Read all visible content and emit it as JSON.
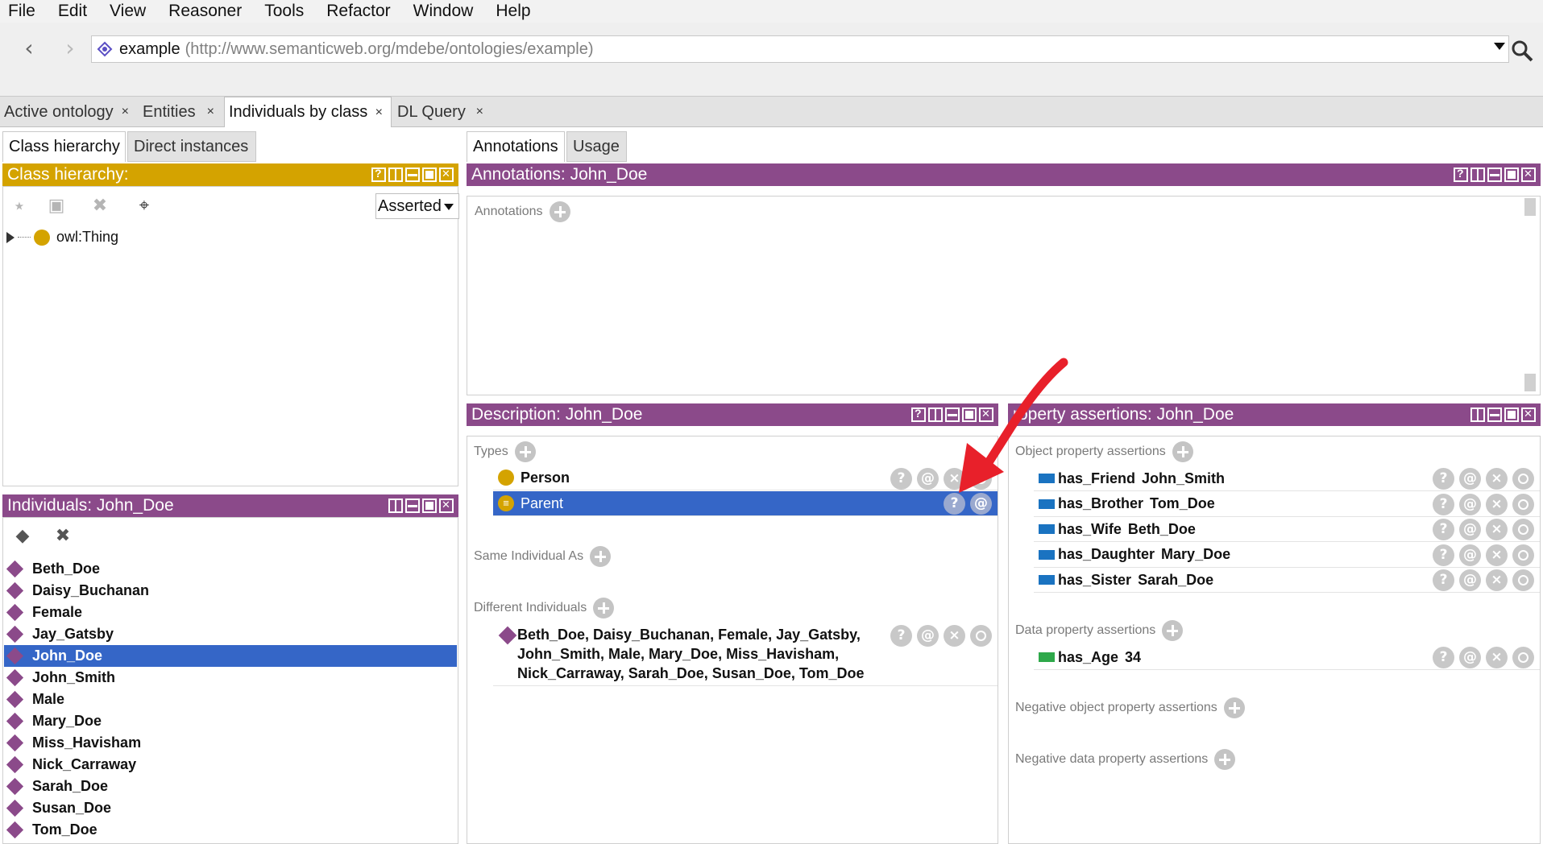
{
  "menu": [
    "File",
    "Edit",
    "View",
    "Reasoner",
    "Tools",
    "Refactor",
    "Window",
    "Help"
  ],
  "address": {
    "name": "example",
    "url": "(http://www.semanticweb.org/mdebe/ontologies/example)"
  },
  "tabs": [
    {
      "label": "Active ontology",
      "close": "×"
    },
    {
      "label": "Entities",
      "close": "×"
    },
    {
      "label": "Individuals by class",
      "close": "×"
    },
    {
      "label": "DL Query",
      "close": "×"
    }
  ],
  "left_subtabs": [
    "Class hierarchy",
    "Direct instances"
  ],
  "right_subtabs": [
    "Annotations",
    "Usage"
  ],
  "class_hierarchy": {
    "title": "Class hierarchy:",
    "mode": "Asserted",
    "root": "owl:Thing"
  },
  "individuals": {
    "title": "Individuals: John_Doe",
    "items": [
      "Beth_Doe",
      "Daisy_Buchanan",
      "Female",
      "Jay_Gatsby",
      "John_Doe",
      "John_Smith",
      "Male",
      "Mary_Doe",
      "Miss_Havisham",
      "Nick_Carraway",
      "Sarah_Doe",
      "Susan_Doe",
      "Tom_Doe"
    ],
    "selected": "John_Doe"
  },
  "annotations": {
    "title": "Annotations: John_Doe",
    "section": "Annotations"
  },
  "description": {
    "title": "Description: John_Doe",
    "types_label": "Types",
    "types": [
      {
        "label": "Person",
        "selected": false
      },
      {
        "label": "Parent",
        "selected": true
      }
    ],
    "same_label": "Same Individual As",
    "different_label": "Different Individuals",
    "different_lines": [
      "Beth_Doe, Daisy_Buchanan, Female, Jay_Gatsby,",
      "John_Smith, Male, Mary_Doe, Miss_Havisham,",
      "Nick_Carraway, Sarah_Doe, Susan_Doe, Tom_Doe"
    ]
  },
  "property_assertions": {
    "title": "roperty assertions: John_Doe",
    "object_label": "Object property assertions",
    "object": [
      {
        "property": "has_Friend",
        "value": "John_Smith"
      },
      {
        "property": "has_Brother",
        "value": "Tom_Doe"
      },
      {
        "property": "has_Wife",
        "value": "Beth_Doe"
      },
      {
        "property": "has_Daughter",
        "value": "Mary_Doe"
      },
      {
        "property": "has_Sister",
        "value": "Sarah_Doe"
      }
    ],
    "data_label": "Data property assertions",
    "data": [
      {
        "property": "has_Age",
        "value": "34"
      }
    ],
    "neg_object_label": "Negative object property assertions",
    "neg_data_label": "Negative data property assertions"
  },
  "buttons": {
    "help": "?",
    "annotate": "@",
    "delete": "×"
  },
  "colors": {
    "class_header": "#d4a300",
    "view_header": "#8b4a8a",
    "selection": "#3566c7",
    "object_property": "#1a73c1",
    "data_property": "#2ea84a",
    "annotation_arrow": "#e8202a"
  }
}
